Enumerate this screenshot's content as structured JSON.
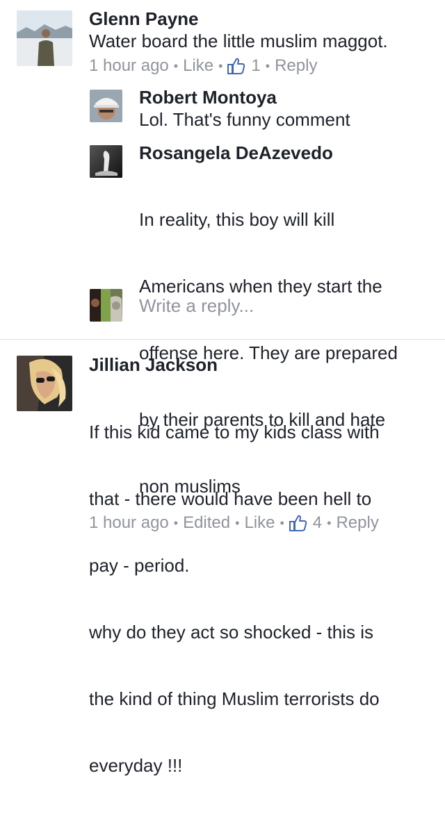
{
  "comments": [
    {
      "author": "Glenn Payne",
      "text": "Water board the little muslim maggot.",
      "time": "1 hour ago",
      "like_label": "Like",
      "like_count": "1",
      "reply_label": "Reply",
      "replies": [
        {
          "author": "Robert Montoya",
          "text": "Lol. That's funny comment"
        },
        {
          "author": "Rosangela DeAzevedo",
          "lines": [
            "In reality, this boy will kill",
            "Americans when they start the",
            "offense here. They are prepared",
            "by their parents to kill and hate",
            "non muslims"
          ]
        }
      ],
      "reply_placeholder": "Write a reply..."
    },
    {
      "author": "Jillian Jackson",
      "lines": [
        "If this kid came to my kids class with",
        "that - there would have been hell to",
        "pay - period.",
        "why do they act so shocked - this is",
        "the kind of thing Muslim terrorists do",
        "everyday !!!"
      ],
      "time": "1 hour ago",
      "edited_label": "Edited",
      "like_label": "Like",
      "like_count": "4",
      "reply_label": "Reply"
    }
  ],
  "icons": {
    "like": "thumbs-up-icon"
  },
  "colors": {
    "meta": "#90949c",
    "text": "#1d2129",
    "like_blue": "#4267b2"
  }
}
